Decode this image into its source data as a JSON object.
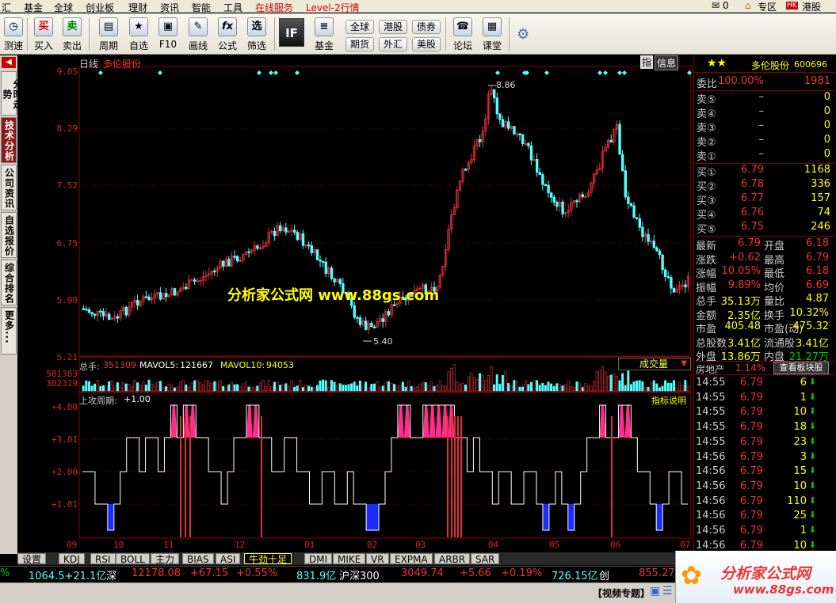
{
  "menu": {
    "items": [
      "汇",
      "基金",
      "全球",
      "创业板",
      "理财",
      "资讯",
      "智能",
      "工具"
    ],
    "online_service": "在线服务",
    "level2": "Level-2行情",
    "mail_count": "0",
    "zone": "专区",
    "hk": "港股"
  },
  "toolbar": {
    "buttons": [
      {
        "label": "测速",
        "icon": "speed-test-icon",
        "glyph": "◷"
      },
      {
        "label": "买入",
        "icon": "buy-icon",
        "glyph": "买"
      },
      {
        "label": "卖出",
        "icon": "sell-icon",
        "glyph": "卖"
      },
      {
        "label": "周期",
        "icon": "period-icon",
        "glyph": "▤"
      },
      {
        "label": "自选",
        "icon": "watchlist-icon",
        "glyph": "★"
      },
      {
        "label": "F10",
        "icon": "f10-icon",
        "glyph": "▣"
      },
      {
        "label": "画线",
        "icon": "draw-line-icon",
        "glyph": "✎"
      },
      {
        "label": "公式",
        "icon": "formula-icon",
        "glyph": "fx"
      },
      {
        "label": "筛选",
        "icon": "screen-icon",
        "glyph": "选"
      },
      {
        "label": "基金",
        "icon": "fund-icon",
        "glyph": "≡"
      },
      {
        "label": "论坛",
        "icon": "forum-icon",
        "glyph": "☎"
      },
      {
        "label": "课堂",
        "icon": "classroom-icon",
        "glyph": "▦"
      }
    ],
    "if_label": "IF",
    "markets": [
      "全球",
      "港股",
      "债券",
      "期货",
      "外汇",
      "美股"
    ]
  },
  "left_tabs": [
    "分时走势",
    "技术分析",
    "公司资讯",
    "自选报价",
    "综合排名",
    "更多..."
  ],
  "chart": {
    "period": "日线",
    "stock_name": "多伦股份",
    "price_ticks": [
      "9.05",
      "8.29",
      "7.52",
      "6.75",
      "5.99",
      "5.21"
    ],
    "high_label": "8.86",
    "low_label": "5.40",
    "watermark": "分析家公式网 www.88gs.com",
    "indicator_button": "指",
    "info_button": "信息",
    "volume": {
      "total_label": "总手:",
      "total_value": "351309",
      "mavol5_label": "MAVOL5:",
      "mavol5_value": "121667",
      "mavol10_label": "MAVOL10:",
      "mavol10_value": "94053",
      "ticks": [
        "581383",
        "302319"
      ],
      "selector": "成交量"
    },
    "indicator": {
      "label": "上攻周期:",
      "value": "+1.00",
      "ticks": [
        "+4.00",
        "+3.01",
        "+2.00",
        "+1.01"
      ],
      "help": "指标说明"
    },
    "months": [
      "09",
      "10",
      "11",
      "12",
      "01",
      "02",
      "03",
      "04",
      "05",
      "06",
      "07"
    ],
    "colors": {
      "up": "#e0303a",
      "down": "#54ffff",
      "grid": "#8b0000",
      "pink": "#ff2e8a"
    }
  },
  "indicator_tabs": [
    "设置",
    "KDJ",
    "RSI",
    "BOLL",
    "主力",
    "BIAS",
    "ASI",
    "牛劲十足",
    "DMI",
    "MIKE",
    "VR",
    "EXPMA",
    "ARBR",
    "SAR"
  ],
  "right_panel": {
    "stock_name": "多伦股份",
    "code": "600696",
    "weibi_label": "委比",
    "weibi_value": "100.00%",
    "weicha_value": "1981",
    "asks": [
      {
        "label": "卖⑤",
        "price": "–",
        "vol": "0"
      },
      {
        "label": "卖④",
        "price": "–",
        "vol": "0"
      },
      {
        "label": "卖③",
        "price": "–",
        "vol": "0"
      },
      {
        "label": "卖②",
        "price": "–",
        "vol": "0"
      },
      {
        "label": "卖①",
        "price": "–",
        "vol": "0"
      }
    ],
    "bids": [
      {
        "label": "买①",
        "price": "6.79",
        "vol": "1168"
      },
      {
        "label": "买②",
        "price": "6.78",
        "vol": "336"
      },
      {
        "label": "买③",
        "price": "6.77",
        "vol": "157"
      },
      {
        "label": "买④",
        "price": "6.76",
        "vol": "74"
      },
      {
        "label": "买⑤",
        "price": "6.75",
        "vol": "246"
      }
    ],
    "stats": [
      {
        "l1": "最新",
        "v1": "6.79",
        "l2": "开盘",
        "v2": "6.18"
      },
      {
        "l1": "涨跌",
        "v1": "+0.62",
        "l2": "最高",
        "v2": "6.79"
      },
      {
        "l1": "涨幅",
        "v1": "10.05%",
        "l2": "最低",
        "v2": "6.18"
      },
      {
        "l1": "振幅",
        "v1": "9.89%",
        "l2": "均价",
        "v2": "6.69"
      },
      {
        "l1": "总手",
        "v1": "35.13万",
        "l2": "量比",
        "v2": "4.87"
      },
      {
        "l1": "金额",
        "v1": "2.35亿",
        "l2": "换手",
        "v2": "10.32%"
      },
      {
        "l1": "市盈",
        "v1": "405.48",
        "l2": "市盈(动)",
        "v2": "475.32"
      },
      {
        "l1": "总股数",
        "v1": "3.41亿",
        "l2": "流通股",
        "v2": "3.41亿"
      },
      {
        "l1": "外盘",
        "v1": "13.86万",
        "l2": "内盘",
        "v2": "21.27万"
      }
    ],
    "sector": "房地产",
    "sector_change": "1.14%",
    "sector_button": "查看板块股",
    "ticks": [
      {
        "time": "14:55",
        "price": "6.79",
        "vol": "6"
      },
      {
        "time": "14:55",
        "price": "6.79",
        "vol": "1"
      },
      {
        "time": "14:55",
        "price": "6.79",
        "vol": "10"
      },
      {
        "time": "14:55",
        "price": "6.79",
        "vol": "18"
      },
      {
        "time": "14:55",
        "price": "6.79",
        "vol": "23"
      },
      {
        "time": "14:56",
        "price": "6.79",
        "vol": "3"
      },
      {
        "time": "14:56",
        "price": "6.79",
        "vol": "15"
      },
      {
        "time": "14:56",
        "price": "6.79",
        "vol": "10"
      },
      {
        "time": "14:56",
        "price": "6.79",
        "vol": "110"
      },
      {
        "time": "14:56",
        "price": "6.79",
        "vol": "25"
      },
      {
        "time": "14:56",
        "price": "6.79",
        "vol": "1"
      },
      {
        "time": "14:56",
        "price": "6.79",
        "vol": "10"
      }
    ]
  },
  "status": {
    "pct": "%",
    "sh_amount": "1064.5+21.1亿",
    "sz_label": "深",
    "sz_index": "12178.08",
    "sz_change": "+67.15",
    "sz_pct": "+0.55%",
    "sz_amount": "831.9亿",
    "hs300_label": "沪深300",
    "hs300_index": "3049.74",
    "hs300_change": "+5.66",
    "hs300_pct": "+0.19%",
    "hs300_amount": "726.15亿",
    "cyb_label": "创",
    "cyb_index": "855.27",
    "video": "【视频专题】"
  },
  "logo": {
    "text": "分析家公式网",
    "url": "www.88gs.com"
  }
}
